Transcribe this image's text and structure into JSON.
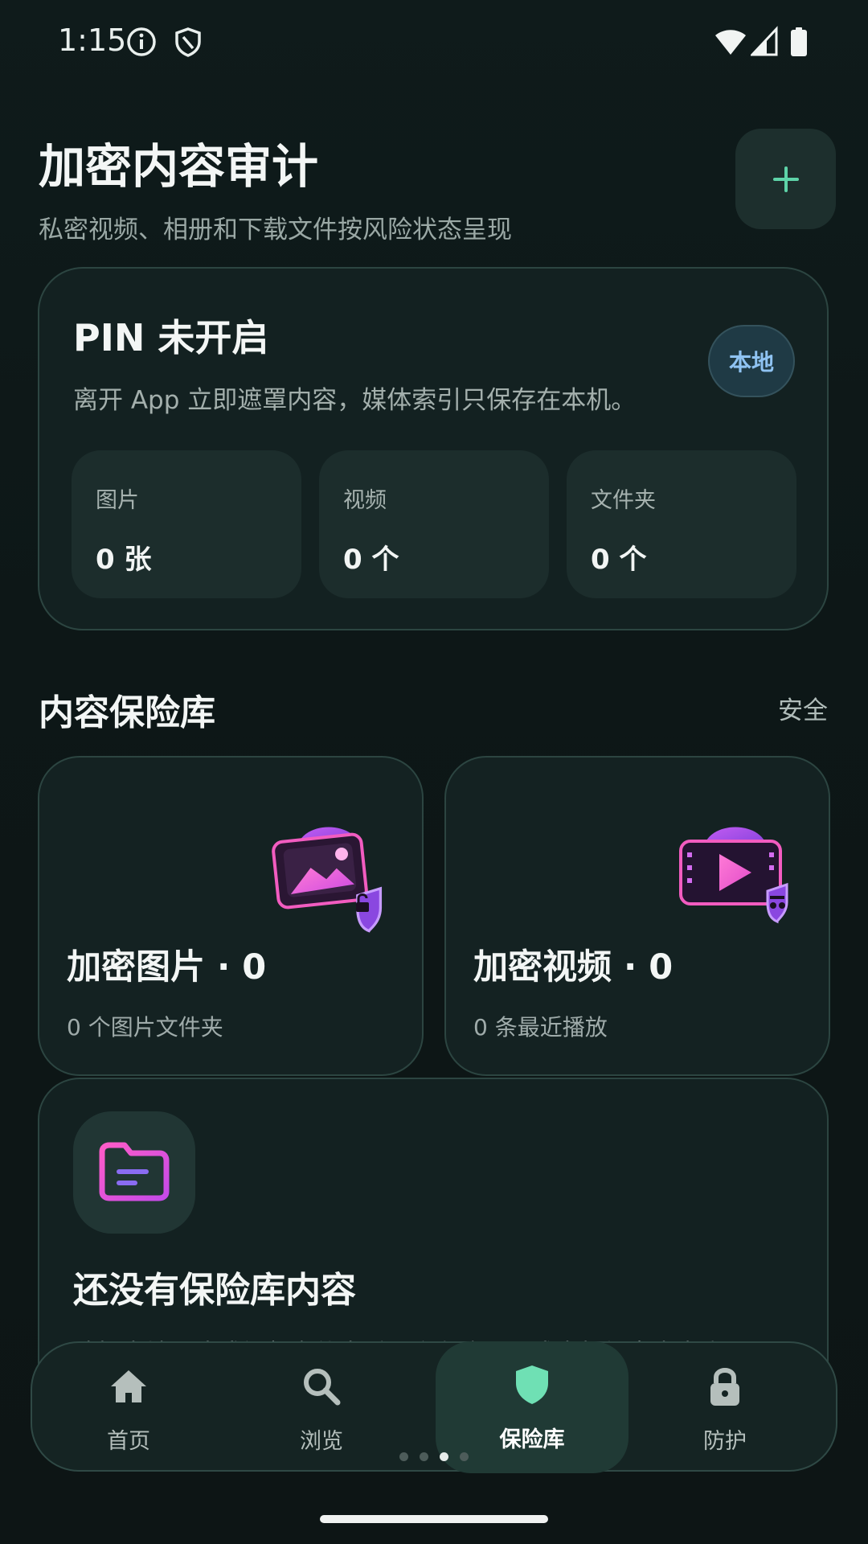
{
  "status_bar": {
    "time": "1:15",
    "icons": [
      "info-icon",
      "shield-outline-icon",
      "wifi-icon",
      "cell-signal-icon",
      "battery-icon"
    ]
  },
  "header": {
    "title": "加密内容审计",
    "subtitle": "私密视频、相册和下载文件按风险状态呈现",
    "add_icon": "plus-icon"
  },
  "pin_card": {
    "title": "PIN 未开启",
    "description": "离开 App 立即遮罩内容，媒体索引只保存在本机。",
    "badge": "本地",
    "stats": [
      {
        "label": "图片",
        "value": "0 张"
      },
      {
        "label": "视频",
        "value": "0 个"
      },
      {
        "label": "文件夹",
        "value": "0 个"
      }
    ]
  },
  "vault_section": {
    "title": "内容保险库",
    "link": "安全",
    "cards": [
      {
        "title": "加密图片 · 0",
        "subtitle": "0 个图片文件夹",
        "icon": "locked-photo-icon"
      },
      {
        "title": "加密视频 · 0",
        "subtitle": "0 条最近播放",
        "icon": "private-video-icon"
      }
    ]
  },
  "empty_state": {
    "icon": "folder-icon",
    "title": "还没有保险库内容",
    "description": "选择本地图片或视频文件夹后，会在这里形成本机加密内容库"
  },
  "bottom_nav": {
    "items": [
      {
        "label": "首页",
        "icon": "home-icon"
      },
      {
        "label": "浏览",
        "icon": "search-icon"
      },
      {
        "label": "保险库",
        "icon": "shield-icon"
      },
      {
        "label": "防护",
        "icon": "lock-icon"
      }
    ],
    "active_index": 2
  },
  "colors": {
    "background": "#0f1a1a",
    "card": "#132121",
    "accent": "#5ed3a8",
    "badge_text": "#8fc3f2",
    "illustration_pink": "#f25cc0",
    "illustration_purple": "#9a5cf2"
  }
}
